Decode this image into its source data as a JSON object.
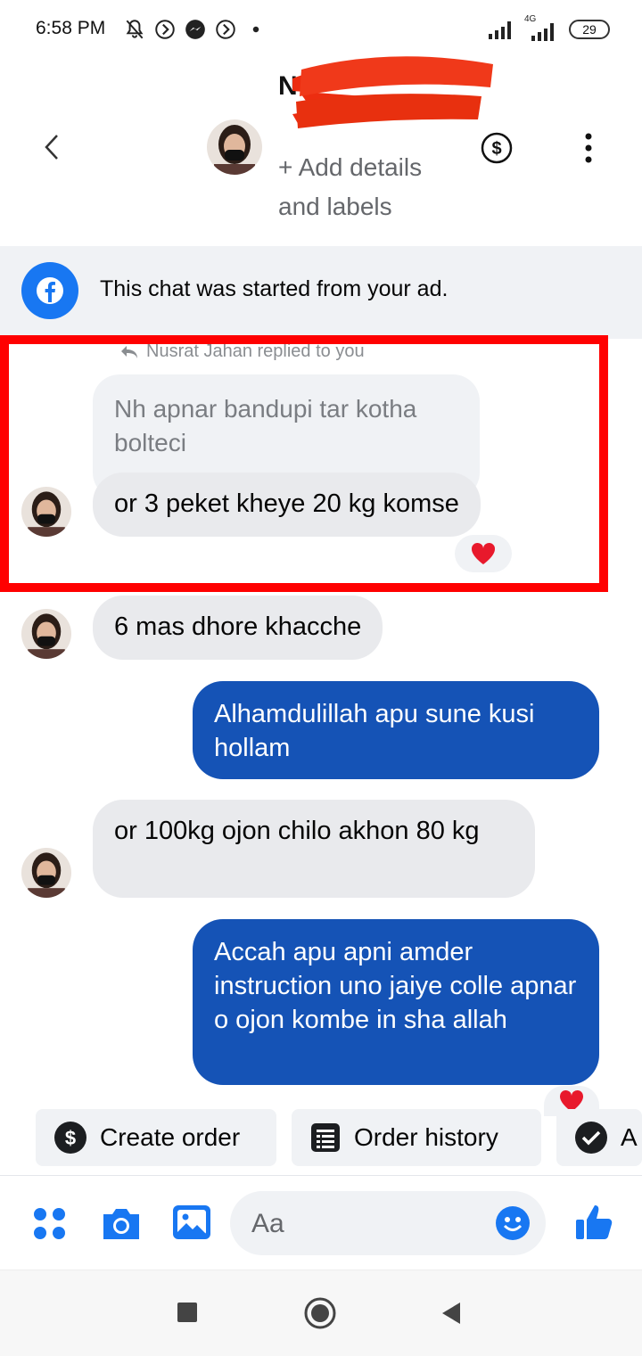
{
  "status_bar": {
    "time": "6:58 PM",
    "network_label": "4G",
    "battery": "29"
  },
  "header": {
    "contact_name": "N",
    "add_details": "+ Add details and labels"
  },
  "banner": {
    "text": "This chat was started from your ad."
  },
  "messages": {
    "replied_label": "Nusrat Jahan replied to you",
    "quoted": "Nh apnar bandupi tar kotha bolteci",
    "m1": "or 3 peket kheye 20 kg komse",
    "m2": "6 mas dhore khacche",
    "m3": "Alhamdulillah apu sune kusi hollam",
    "m4": "or 100kg ojon chilo akhon 80 kg",
    "m5": "Accah apu apni amder instruction uno jaiye colle apnar o ojon kombe in sha allah"
  },
  "quick_actions": {
    "create_order": "Create order",
    "order_history": "Order history",
    "third": "A"
  },
  "composer": {
    "placeholder": "Aa"
  },
  "colors": {
    "accent": "#1877f2",
    "outgoing_bubble": "#1553b6",
    "highlight": "#ff0000"
  }
}
